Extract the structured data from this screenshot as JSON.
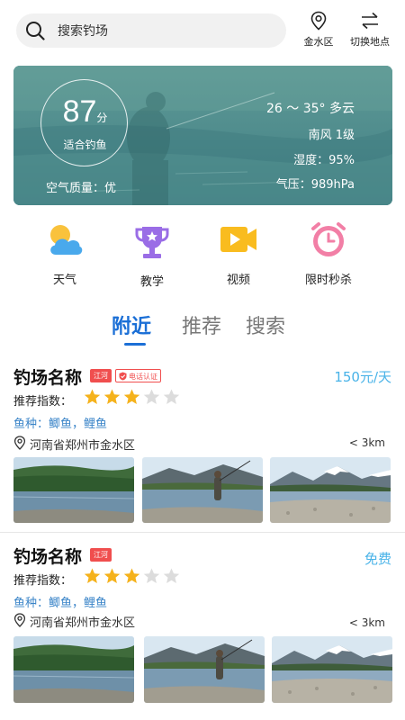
{
  "search": {
    "placeholder": "搜索钓场"
  },
  "header": {
    "location_label": "金水区",
    "switch_label": "切换地点"
  },
  "weather": {
    "score": "87",
    "score_unit": "分",
    "suitability": "适合钓鱼",
    "air_quality": "空气质量：优",
    "temperature": "26 ～ 35° 多云",
    "wind": "南风 1级",
    "humidity": "湿度：95%",
    "pressure": "气压：989hPa"
  },
  "categories": [
    {
      "label": "天气",
      "icon": "weather-icon"
    },
    {
      "label": "教学",
      "icon": "trophy-icon"
    },
    {
      "label": "视频",
      "icon": "video-icon"
    },
    {
      "label": "限时秒杀",
      "icon": "alarm-clock-icon"
    }
  ],
  "tabs": [
    {
      "label": "附近",
      "active": true
    },
    {
      "label": "推荐",
      "active": false
    },
    {
      "label": "搜索",
      "active": false
    }
  ],
  "listings": [
    {
      "name": "钓场名称",
      "tag": "江河",
      "verify": "电话认证",
      "price": "150元/天",
      "rating_label": "推荐指数：",
      "rating": 3,
      "rating_max": 5,
      "fish": "鱼种：鲫鱼，鲤鱼",
      "address": "河南省郑州市金水区",
      "distance": "< 3km"
    },
    {
      "name": "钓场名称",
      "tag": "江河",
      "price": "免费",
      "rating_label": "推荐指数：",
      "rating": 3,
      "rating_max": 5,
      "fish": "鱼种：鲫鱼，鲤鱼",
      "address": "河南省郑州市金水区",
      "distance": "< 3km"
    }
  ],
  "colors": {
    "accent": "#1b6fd6",
    "price": "#49b3e8",
    "badge_red": "#f04e4e",
    "star_on": "#f5b21c",
    "star_off": "#dcdcdc",
    "card_teal": "#4d8f90"
  }
}
